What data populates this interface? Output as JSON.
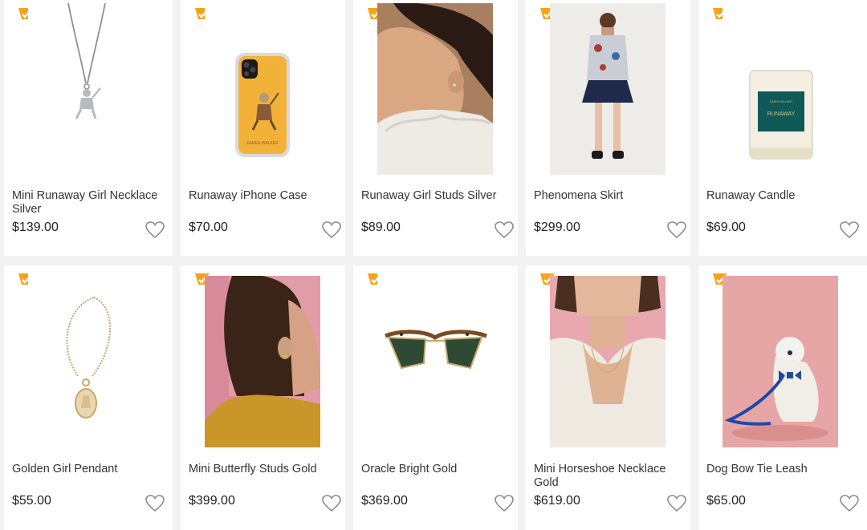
{
  "brand": {
    "badge_color": "#f6a31b",
    "heart_color": "#8c8c8c"
  },
  "products": [
    {
      "name": "Mini Runaway Girl Necklace Silver",
      "price": "$139.00",
      "image": "silver-runaway-girl-necklace"
    },
    {
      "name": "Runaway iPhone Case",
      "price": "$70.00",
      "image": "yellow-runaway-phone-case",
      "case_text": "KAREN WALKER"
    },
    {
      "name": "Runaway Girl Studs Silver",
      "price": "$89.00",
      "image": "model-with-silver-stud"
    },
    {
      "name": "Phenomena Skirt",
      "price": "$299.00",
      "image": "model-in-navy-skirt"
    },
    {
      "name": "Runaway Candle",
      "price": "$69.00",
      "image": "runaway-candle-jar",
      "candle_text": "RUNAWAY",
      "candle_brand": "KAREN WALKER"
    },
    {
      "name": "Golden Girl Pendant",
      "price": "$55.00",
      "image": "gold-cameo-pendant"
    },
    {
      "name": "Mini Butterfly Studs Gold",
      "price": "$399.00",
      "image": "model-with-gold-stud"
    },
    {
      "name": "Oracle Bright Gold",
      "price": "$369.00",
      "image": "tortoise-sunglasses"
    },
    {
      "name": "Mini Horseshoe Necklace Gold",
      "price": "$619.00",
      "image": "model-with-gold-necklace"
    },
    {
      "name": "Dog Bow Tie Leash",
      "price": "$65.00",
      "image": "westie-with-blue-leash"
    }
  ]
}
